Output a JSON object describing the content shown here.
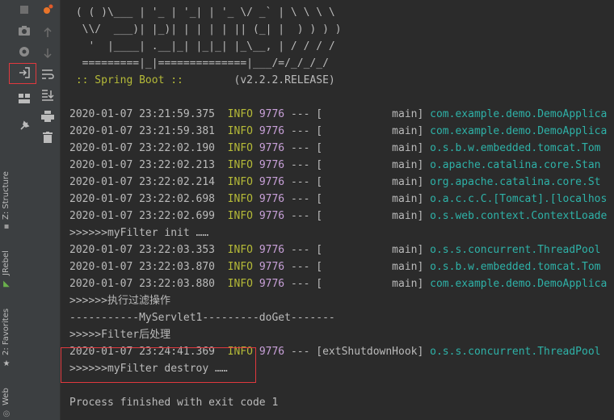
{
  "side_tabs": {
    "structure": "Z: Structure",
    "jrebel": "JRebel",
    "favorites": "2: Favorites",
    "web": "Web"
  },
  "banner": {
    "lines": [
      " ( ( )\\___ | '_ | '_| | '_ \\/ _` | \\ \\ \\ \\",
      "  \\\\/  ___)| |_)| | | | | || (_| |  ) ) ) )",
      "   '  |____| .__|_| |_|_| |_\\__, | / / / /",
      "  =========|_|==============|___/=/_/_/_/"
    ],
    "spring_label": " :: Spring Boot :: ",
    "version": "       (v2.2.2.RELEASE)"
  },
  "log": [
    {
      "type": "log",
      "ts": "2020-01-07 23:21:59.375",
      "level": "INFO",
      "pid": "9776",
      "dash": "---",
      "thread": "[           main]",
      "logger": "com.example.demo.DemoApplica",
      "lc": "#2eb2a8"
    },
    {
      "type": "log",
      "ts": "2020-01-07 23:21:59.381",
      "level": "INFO",
      "pid": "9776",
      "dash": "---",
      "thread": "[           main]",
      "logger": "com.example.demo.DemoApplica",
      "lc": "#2eb2a8"
    },
    {
      "type": "log",
      "ts": "2020-01-07 23:22:02.190",
      "level": "INFO",
      "pid": "9776",
      "dash": "---",
      "thread": "[           main]",
      "logger": "o.s.b.w.embedded.tomcat.Tom",
      "lc": "#2eb2a8"
    },
    {
      "type": "log",
      "ts": "2020-01-07 23:22:02.213",
      "level": "INFO",
      "pid": "9776",
      "dash": "---",
      "thread": "[           main]",
      "logger": "o.apache.catalina.core.Stan",
      "lc": "#2eb2a8"
    },
    {
      "type": "log",
      "ts": "2020-01-07 23:22:02.214",
      "level": "INFO",
      "pid": "9776",
      "dash": "---",
      "thread": "[           main]",
      "logger": "org.apache.catalina.core.St",
      "lc": "#2eb2a8"
    },
    {
      "type": "log",
      "ts": "2020-01-07 23:22:02.698",
      "level": "INFO",
      "pid": "9776",
      "dash": "---",
      "thread": "[           main]",
      "logger": "o.a.c.c.C.[Tomcat].[localhos",
      "lc": "#2eb2a8"
    },
    {
      "type": "log",
      "ts": "2020-01-07 23:22:02.699",
      "level": "INFO",
      "pid": "9776",
      "dash": "---",
      "thread": "[           main]",
      "logger": "o.s.web.context.ContextLoade",
      "lc": "#2eb2a8"
    },
    {
      "type": "text",
      "text": ">>>>>>myFilter init ……"
    },
    {
      "type": "log",
      "ts": "2020-01-07 23:22:03.353",
      "level": "INFO",
      "pid": "9776",
      "dash": "---",
      "thread": "[           main]",
      "logger": "o.s.s.concurrent.ThreadPool",
      "lc": "#2eb2a8"
    },
    {
      "type": "log",
      "ts": "2020-01-07 23:22:03.870",
      "level": "INFO",
      "pid": "9776",
      "dash": "---",
      "thread": "[           main]",
      "logger": "o.s.b.w.embedded.tomcat.Tom",
      "lc": "#2eb2a8"
    },
    {
      "type": "log",
      "ts": "2020-01-07 23:22:03.880",
      "level": "INFO",
      "pid": "9776",
      "dash": "---",
      "thread": "[           main]",
      "logger": "com.example.demo.DemoApplica",
      "lc": "#2eb2a8"
    },
    {
      "type": "text",
      "text": ">>>>>>执行过滤操作"
    },
    {
      "type": "text",
      "text": "-----------MyServlet1---------doGet-------"
    },
    {
      "type": "text",
      "text": ">>>>>Filter后处理"
    },
    {
      "type": "log",
      "ts": "2020-01-07 23:24:41.369",
      "level": "INFO",
      "pid": "9776",
      "dash": "---",
      "thread": "[extShutdownHook]",
      "logger": "o.s.s.concurrent.ThreadPool",
      "lc": "#2eb2a8"
    },
    {
      "type": "text",
      "text": ">>>>>>myFilter destroy ……"
    },
    {
      "type": "blank",
      "text": ""
    },
    {
      "type": "text",
      "text": "Process finished with exit code 1"
    }
  ]
}
